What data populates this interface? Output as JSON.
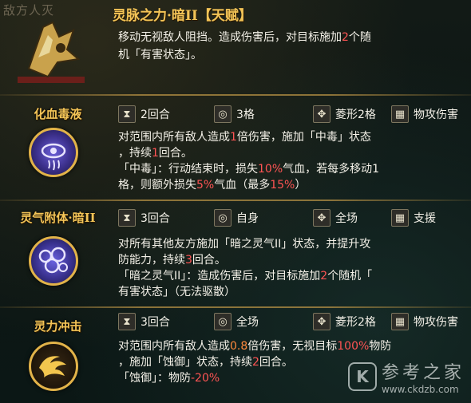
{
  "header": {
    "faded_text": "敌方人灭",
    "title": "灵脉之力·暗II【天赋】",
    "desc_line1": "移动无视敌人阻挡。造成伤害后，对目标施加",
    "desc_num": "2",
    "desc_line1_tail": "个随",
    "desc_line2": "机「有害状态」。"
  },
  "skills": [
    {
      "name": "化血毒液",
      "stats": [
        {
          "icon": "hourglass-icon",
          "text": "2回合"
        },
        {
          "icon": "range-icon",
          "text": "3格"
        },
        {
          "icon": "target-icon",
          "text": "菱形2格"
        },
        {
          "icon": "grid-icon",
          "text": "物攻伤害"
        }
      ],
      "desc": {
        "l1a": "对范围内所有敌人造成",
        "l1b": "1",
        "l1c": "倍伤害，施加「中毒」状态",
        "l2a": "，持续",
        "l2b": "1",
        "l2c": "回合。",
        "l3a": "「中毒」：行动结束时，损失",
        "l3b": "10%",
        "l3c": "气血，若每多移动1",
        "l4a": "格，则额外损失",
        "l4b": "5%",
        "l4c": "气血（最多",
        "l4d": "15%",
        "l4e": "）"
      }
    },
    {
      "name": "灵气附体·暗II",
      "stats": [
        {
          "icon": "hourglass-icon",
          "text": "3回合"
        },
        {
          "icon": "range-icon",
          "text": "自身"
        },
        {
          "icon": "target-icon",
          "text": "全场"
        },
        {
          "icon": "grid-icon",
          "text": "支援"
        }
      ],
      "desc": {
        "l1": "对所有其他友方施加「暗之灵气II」状态，并提升攻",
        "l2a": "防能力，持续",
        "l2b": "3",
        "l2c": "回合。",
        "l3a": "「暗之灵气II」：造成伤害后，对目标施加",
        "l3b": "2",
        "l3c": "个随机「",
        "l4": "有害状态」（无法驱散）"
      }
    },
    {
      "name": "灵力冲击",
      "stats": [
        {
          "icon": "hourglass-icon",
          "text": "3回合"
        },
        {
          "icon": "range-icon",
          "text": "全场"
        },
        {
          "icon": "target-icon",
          "text": "菱形2格"
        },
        {
          "icon": "grid-icon",
          "text": "物攻伤害"
        }
      ],
      "desc": {
        "l1a": "对范围内所有敌人造成",
        "l1b": "0.8",
        "l1c": "倍伤害，无视目标",
        "l1d": "100%",
        "l1e": "物防",
        "l2a": "，施加「蚀御」状态，持续",
        "l2b": "2",
        "l2c": "回合。",
        "l3a": "「蚀御」：物防",
        "l3b": "-20%"
      }
    }
  ],
  "watermark": {
    "logo": "K",
    "cn": "参考之家",
    "url": "www.ckdzb.com"
  },
  "colors": {
    "gold": "#f3c457",
    "highlight_red": "#ff5454",
    "highlight_orange": "#ff8a3d"
  }
}
